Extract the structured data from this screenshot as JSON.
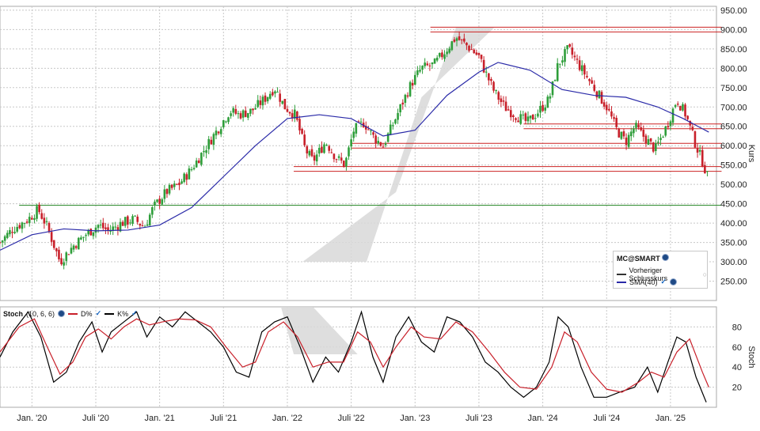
{
  "chart_data": [
    {
      "type": "candlestick",
      "symbol_label": "MC@SMART",
      "ylabel": "Kurs",
      "ylim": [
        200,
        960
      ],
      "yticks": [
        "250.00",
        "300.00",
        "350.00",
        "400.00",
        "450.00",
        "500.00",
        "550.00",
        "600.00",
        "650.00",
        "700.00",
        "750.00",
        "800.00",
        "850.00",
        "900.00",
        "950.00"
      ],
      "x_ticks": [
        "Jan. '20",
        "Juli '20",
        "Jan. '21",
        "Juli '21",
        "Jan. '22",
        "Juli '22",
        "Jan. '23",
        "Juli '23",
        "Jan. '24",
        "Juli '24",
        "Jan. '25"
      ],
      "x_tick_dates": [
        "2020-01",
        "2020-07",
        "2021-01",
        "2021-07",
        "2022-01",
        "2022-07",
        "2023-01",
        "2023-07",
        "2024-01",
        "2024-07",
        "2025-01"
      ],
      "close_path": [
        [
          2019.75,
          350
        ],
        [
          2019.85,
          385
        ],
        [
          2019.97,
          410
        ],
        [
          2020.05,
          435
        ],
        [
          2020.12,
          390
        ],
        [
          2020.22,
          300
        ],
        [
          2020.32,
          340
        ],
        [
          2020.42,
          370
        ],
        [
          2020.52,
          395
        ],
        [
          2020.6,
          380
        ],
        [
          2020.7,
          400
        ],
        [
          2020.8,
          410
        ],
        [
          2020.88,
          390
        ],
        [
          2020.95,
          440
        ],
        [
          2021.05,
          480
        ],
        [
          2021.15,
          500
        ],
        [
          2021.25,
          540
        ],
        [
          2021.35,
          590
        ],
        [
          2021.45,
          640
        ],
        [
          2021.55,
          690
        ],
        [
          2021.62,
          680
        ],
        [
          2021.72,
          690
        ],
        [
          2021.82,
          720
        ],
        [
          2021.9,
          750
        ],
        [
          2021.98,
          700
        ],
        [
          2022.06,
          680
        ],
        [
          2022.14,
          590
        ],
        [
          2022.2,
          560
        ],
        [
          2022.3,
          610
        ],
        [
          2022.38,
          570
        ],
        [
          2022.45,
          550
        ],
        [
          2022.52,
          640
        ],
        [
          2022.6,
          660
        ],
        [
          2022.68,
          620
        ],
        [
          2022.75,
          600
        ],
        [
          2022.82,
          650
        ],
        [
          2022.9,
          710
        ],
        [
          2022.97,
          760
        ],
        [
          2023.05,
          800
        ],
        [
          2023.15,
          810
        ],
        [
          2023.25,
          850
        ],
        [
          2023.32,
          880
        ],
        [
          2023.4,
          860
        ],
        [
          2023.5,
          830
        ],
        [
          2023.55,
          790
        ],
        [
          2023.62,
          740
        ],
        [
          2023.7,
          700
        ],
        [
          2023.78,
          680
        ],
        [
          2023.88,
          660
        ],
        [
          2023.97,
          690
        ],
        [
          2024.05,
          720
        ],
        [
          2024.12,
          810
        ],
        [
          2024.2,
          850
        ],
        [
          2024.3,
          800
        ],
        [
          2024.4,
          750
        ],
        [
          2024.5,
          700
        ],
        [
          2024.58,
          640
        ],
        [
          2024.65,
          610
        ],
        [
          2024.72,
          650
        ],
        [
          2024.8,
          620
        ],
        [
          2024.88,
          590
        ],
        [
          2024.97,
          650
        ],
        [
          2025.05,
          720
        ],
        [
          2025.12,
          680
        ],
        [
          2025.2,
          600
        ],
        [
          2025.25,
          560
        ],
        [
          2025.3,
          510
        ]
      ],
      "series": [
        {
          "name": "SMA(40)",
          "color": "#2a2aa8",
          "points": [
            [
              2019.75,
              330
            ],
            [
              2020.0,
              370
            ],
            [
              2020.25,
              385
            ],
            [
              2020.5,
              380
            ],
            [
              2020.75,
              382
            ],
            [
              2021.0,
              395
            ],
            [
              2021.25,
              440
            ],
            [
              2021.5,
              520
            ],
            [
              2021.75,
              600
            ],
            [
              2022.0,
              670
            ],
            [
              2022.25,
              680
            ],
            [
              2022.5,
              670
            ],
            [
              2022.75,
              625
            ],
            [
              2023.0,
              640
            ],
            [
              2023.25,
              730
            ],
            [
              2023.5,
              790
            ],
            [
              2023.65,
              815
            ],
            [
              2023.9,
              795
            ],
            [
              2024.15,
              745
            ],
            [
              2024.4,
              730
            ],
            [
              2024.65,
              725
            ],
            [
              2024.9,
              700
            ],
            [
              2025.1,
              670
            ],
            [
              2025.3,
              635
            ]
          ]
        }
      ],
      "legend": [
        {
          "label": "Vorheriger Schlusskurs",
          "style": "dashed",
          "color": "#333333"
        },
        {
          "label": "SMA(40)",
          "style": "solid",
          "color": "#2a2aa8"
        }
      ],
      "resistance_lines": [
        {
          "from": 2023.12,
          "to": 2025.4,
          "value": 900,
          "color": "#cc2222"
        },
        {
          "from": 2023.85,
          "to": 2025.4,
          "value": 650,
          "color": "#cc2222"
        },
        {
          "from": 2022.5,
          "to": 2025.4,
          "value": 600,
          "color": "#cc2222"
        },
        {
          "from": 2022.05,
          "to": 2025.4,
          "value": 540,
          "color": "#cc2222"
        },
        {
          "from": 2019.9,
          "to": 2025.4,
          "value": 440,
          "color": "#2e8b2e"
        }
      ],
      "colors": {
        "up": "#2e9e3a",
        "down": "#c8202a",
        "grid": "#c8c8c8",
        "channel": "#d8d8d8"
      }
    },
    {
      "type": "line",
      "title": "Stoch",
      "params": "(10, 6, 6)",
      "ylim": [
        0,
        100
      ],
      "yticks": [
        "20",
        "40",
        "60",
        "80"
      ],
      "ylabel": "Stoch",
      "series": [
        {
          "name": "K%",
          "color": "#000000",
          "points": [
            [
              2019.75,
              50
            ],
            [
              2019.85,
              75
            ],
            [
              2019.97,
              95
            ],
            [
              2020.07,
              70
            ],
            [
              2020.17,
              25
            ],
            [
              2020.27,
              35
            ],
            [
              2020.37,
              65
            ],
            [
              2020.47,
              85
            ],
            [
              2020.55,
              55
            ],
            [
              2020.62,
              75
            ],
            [
              2020.72,
              85
            ],
            [
              2020.82,
              95
            ],
            [
              2020.9,
              70
            ],
            [
              2021.0,
              90
            ],
            [
              2021.1,
              80
            ],
            [
              2021.2,
              95
            ],
            [
              2021.3,
              85
            ],
            [
              2021.4,
              75
            ],
            [
              2021.5,
              60
            ],
            [
              2021.6,
              35
            ],
            [
              2021.7,
              30
            ],
            [
              2021.8,
              75
            ],
            [
              2021.9,
              85
            ],
            [
              2022.0,
              90
            ],
            [
              2022.1,
              60
            ],
            [
              2022.2,
              25
            ],
            [
              2022.3,
              50
            ],
            [
              2022.4,
              35
            ],
            [
              2022.5,
              65
            ],
            [
              2022.58,
              95
            ],
            [
              2022.67,
              50
            ],
            [
              2022.75,
              25
            ],
            [
              2022.85,
              70
            ],
            [
              2022.95,
              90
            ],
            [
              2023.05,
              65
            ],
            [
              2023.15,
              55
            ],
            [
              2023.25,
              90
            ],
            [
              2023.35,
              85
            ],
            [
              2023.45,
              70
            ],
            [
              2023.55,
              45
            ],
            [
              2023.65,
              35
            ],
            [
              2023.75,
              20
            ],
            [
              2023.85,
              10
            ],
            [
              2023.95,
              20
            ],
            [
              2024.05,
              45
            ],
            [
              2024.12,
              90
            ],
            [
              2024.2,
              80
            ],
            [
              2024.3,
              40
            ],
            [
              2024.4,
              10
            ],
            [
              2024.5,
              10
            ],
            [
              2024.6,
              15
            ],
            [
              2024.72,
              20
            ],
            [
              2024.82,
              40
            ],
            [
              2024.9,
              15
            ],
            [
              2024.98,
              45
            ],
            [
              2025.05,
              70
            ],
            [
              2025.12,
              65
            ],
            [
              2025.2,
              30
            ],
            [
              2025.28,
              5
            ]
          ]
        },
        {
          "name": "D%",
          "color": "#c8202a",
          "points": [
            [
              2019.75,
              55
            ],
            [
              2019.9,
              80
            ],
            [
              2020.02,
              88
            ],
            [
              2020.12,
              60
            ],
            [
              2020.22,
              33
            ],
            [
              2020.32,
              45
            ],
            [
              2020.42,
              70
            ],
            [
              2020.52,
              78
            ],
            [
              2020.62,
              68
            ],
            [
              2020.72,
              80
            ],
            [
              2020.82,
              88
            ],
            [
              2020.92,
              82
            ],
            [
              2021.02,
              85
            ],
            [
              2021.15,
              88
            ],
            [
              2021.28,
              87
            ],
            [
              2021.4,
              80
            ],
            [
              2021.52,
              60
            ],
            [
              2021.65,
              40
            ],
            [
              2021.75,
              45
            ],
            [
              2021.85,
              75
            ],
            [
              2021.97,
              85
            ],
            [
              2022.08,
              70
            ],
            [
              2022.2,
              40
            ],
            [
              2022.32,
              45
            ],
            [
              2022.44,
              45
            ],
            [
              2022.55,
              75
            ],
            [
              2022.65,
              65
            ],
            [
              2022.75,
              40
            ],
            [
              2022.85,
              60
            ],
            [
              2022.97,
              80
            ],
            [
              2023.07,
              70
            ],
            [
              2023.2,
              68
            ],
            [
              2023.32,
              85
            ],
            [
              2023.45,
              75
            ],
            [
              2023.58,
              55
            ],
            [
              2023.7,
              35
            ],
            [
              2023.82,
              20
            ],
            [
              2023.95,
              18
            ],
            [
              2024.07,
              40
            ],
            [
              2024.17,
              75
            ],
            [
              2024.27,
              65
            ],
            [
              2024.38,
              35
            ],
            [
              2024.5,
              18
            ],
            [
              2024.62,
              15
            ],
            [
              2024.75,
              25
            ],
            [
              2024.85,
              35
            ],
            [
              2024.95,
              30
            ],
            [
              2025.05,
              55
            ],
            [
              2025.15,
              68
            ],
            [
              2025.25,
              35
            ],
            [
              2025.3,
              20
            ]
          ]
        }
      ],
      "channel": true
    }
  ]
}
